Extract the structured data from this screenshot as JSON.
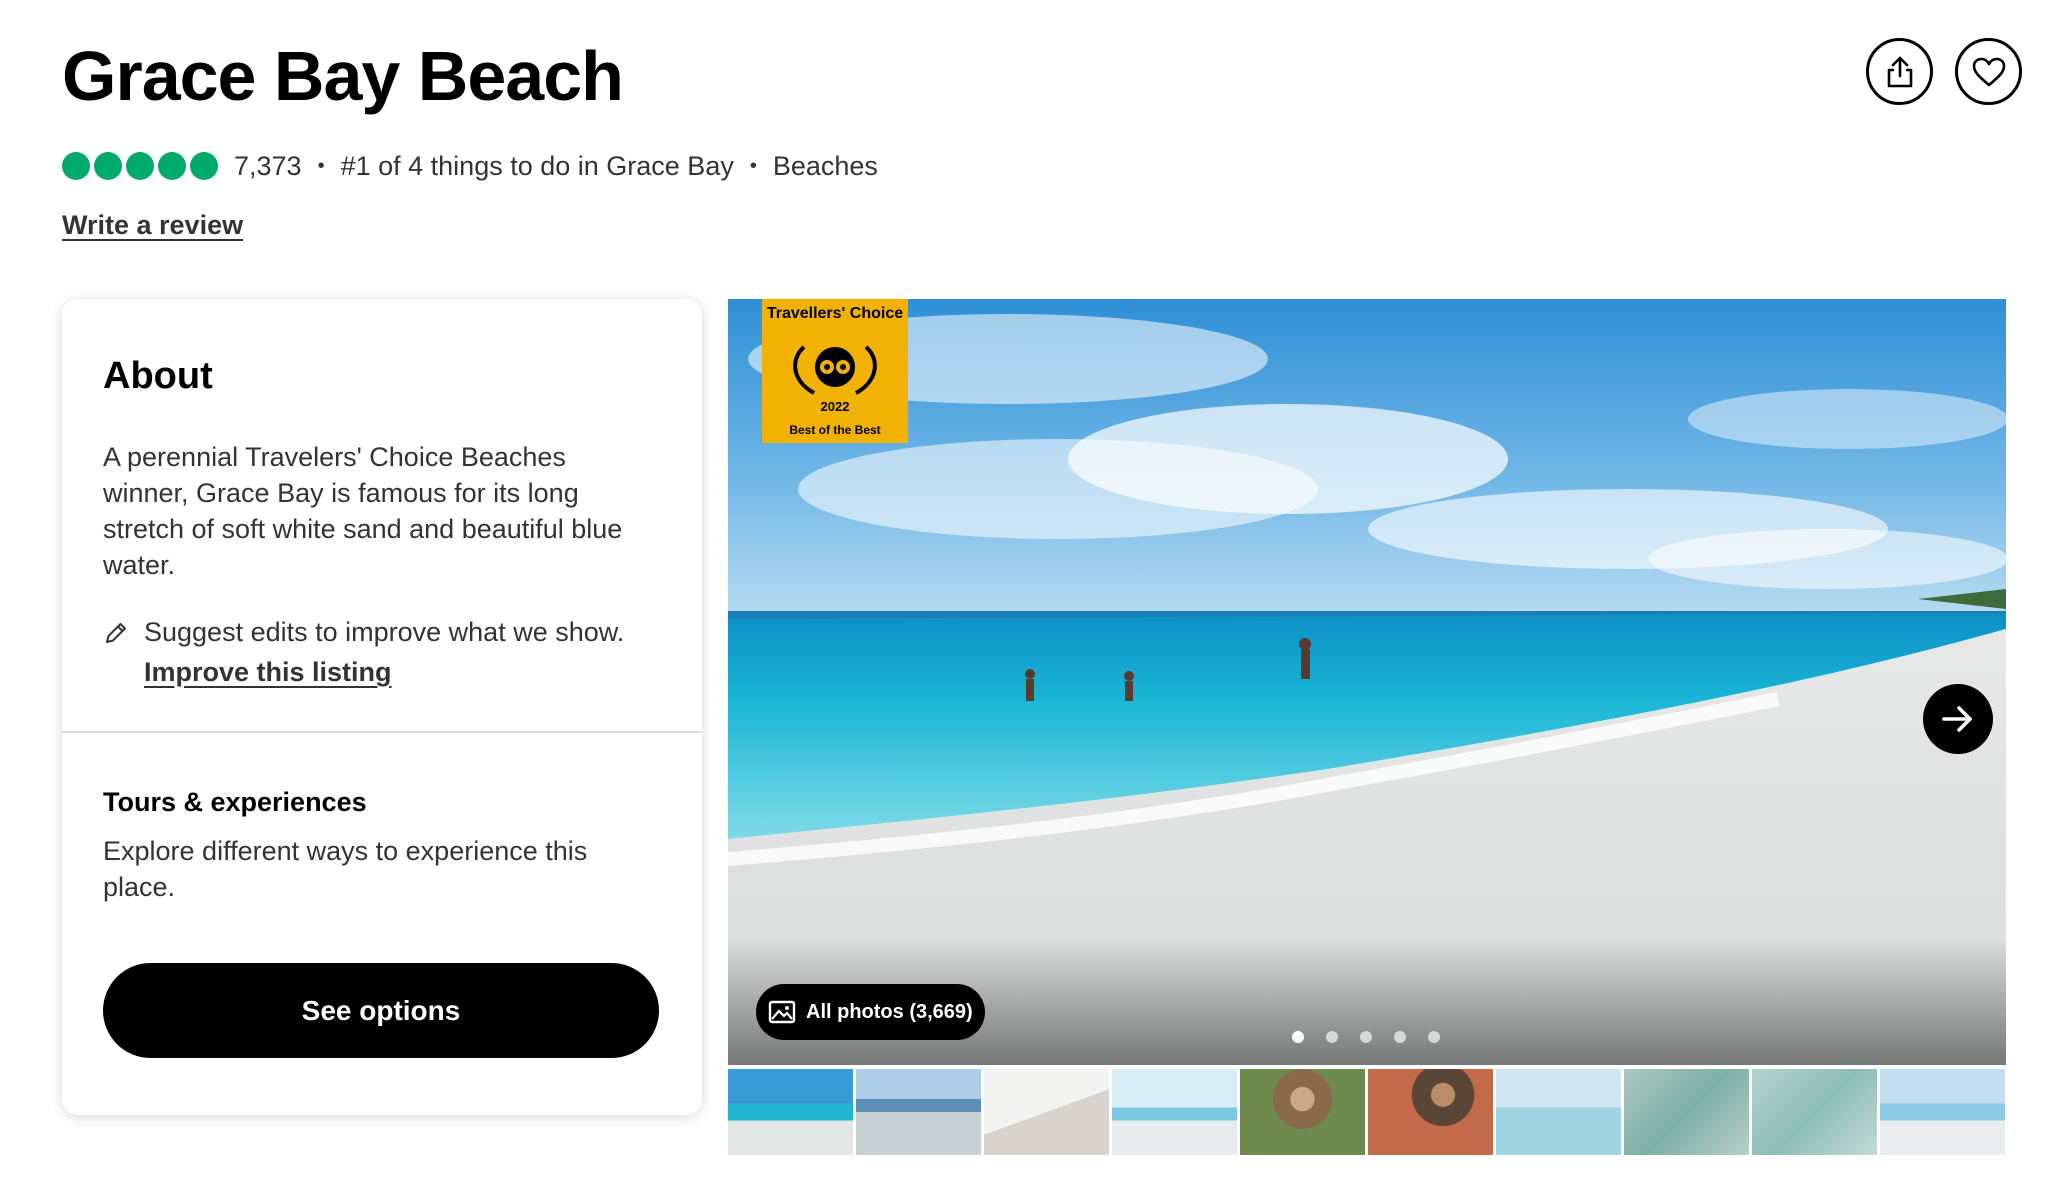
{
  "header": {
    "title": "Grace Bay Beach",
    "share_icon": "share-icon",
    "save_icon": "heart-icon"
  },
  "rating": {
    "bubbles": 5,
    "bubble_color": "#00aa6c",
    "review_count": "7,373",
    "rank_text": "#1 of 4 things to do in Grace Bay",
    "category": "Beaches",
    "separator": "•"
  },
  "write_review": "Write a review",
  "about": {
    "title": "About",
    "description": "A perennial Travelers' Choice Beaches winner, Grace Bay is famous for its long stretch of soft white sand and beautiful blue water.",
    "suggest_text": "Suggest edits to improve what we show.",
    "improve_link": "Improve this listing"
  },
  "tours": {
    "title": "Tours & experiences",
    "description": "Explore different ways to experience this place.",
    "button": "See options"
  },
  "gallery": {
    "badge_top": "Travellers' Choice",
    "badge_year": "2022",
    "badge_bottom": "Best of the Best",
    "all_photos": "All photos (3,669)",
    "dot_count": 5,
    "active_dot": 1,
    "thumbnail_count": 10
  },
  "colors": {
    "accent": "#00aa6c",
    "badge": "#f2b203",
    "button": "#000000"
  }
}
